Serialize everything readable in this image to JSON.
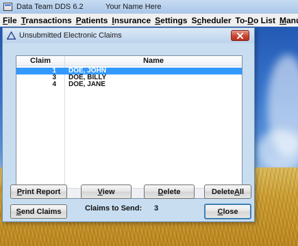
{
  "app": {
    "title": "Data Team DDS 6.2",
    "user": "Your Name Here"
  },
  "menu": [
    {
      "pre": "",
      "key": "F",
      "post": "ile"
    },
    {
      "pre": "",
      "key": "T",
      "post": "ransactions"
    },
    {
      "pre": "",
      "key": "P",
      "post": "atients"
    },
    {
      "pre": "",
      "key": "I",
      "post": "nsurance"
    },
    {
      "pre": "",
      "key": "S",
      "post": "ettings"
    },
    {
      "pre": "S",
      "key": "c",
      "post": "heduler"
    },
    {
      "pre": "To-",
      "key": "D",
      "post": "o List"
    },
    {
      "pre": "",
      "key": "M",
      "post": "anu"
    }
  ],
  "dialog": {
    "title": "Unsubmitted Electronic Claims",
    "icon": "warning-triangle-icon"
  },
  "list": {
    "columns": [
      "Claim",
      "Name"
    ],
    "rows": [
      {
        "claim": "1",
        "name": "DOE, JOHN",
        "selected": true
      },
      {
        "claim": "3",
        "name": "DOE, BILLY",
        "selected": false
      },
      {
        "claim": "4",
        "name": "DOE, JANE",
        "selected": false
      }
    ]
  },
  "buttons": {
    "print_report": {
      "pre": "",
      "key": "P",
      "post": "rint Report"
    },
    "view": {
      "pre": "",
      "key": "V",
      "post": "iew"
    },
    "delete": {
      "pre": "",
      "key": "D",
      "post": "elete"
    },
    "delete_all": {
      "pre": "Delete ",
      "key": "A",
      "post": "ll"
    },
    "send_claims": {
      "pre": "",
      "key": "S",
      "post": "end Claims"
    },
    "close": {
      "pre": "",
      "key": "C",
      "post": "lose"
    }
  },
  "claims_to_send": {
    "label": "Claims to Send:",
    "value": "3"
  },
  "colors": {
    "selection": "#3399ff",
    "close_button": "#c9452f"
  }
}
